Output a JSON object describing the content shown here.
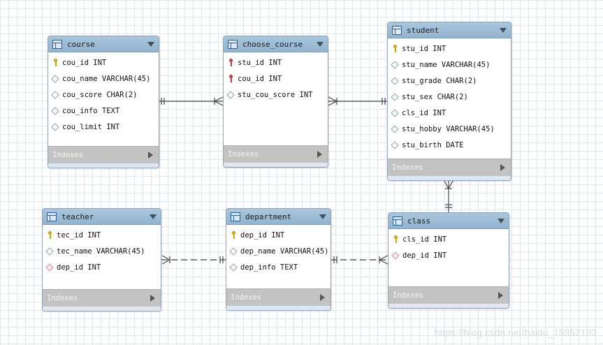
{
  "tables": [
    {
      "name": "course",
      "columns": [
        {
          "icon": "primary-key",
          "text": "cou_id INT"
        },
        {
          "icon": "column",
          "text": "cou_name VARCHAR(45)"
        },
        {
          "icon": "column",
          "text": "cou_score CHAR(2)"
        },
        {
          "icon": "column",
          "text": "cou_info TEXT"
        },
        {
          "icon": "column",
          "text": "cou_limit INT"
        }
      ],
      "footer": "Indexes"
    },
    {
      "name": "choose_course",
      "columns": [
        {
          "icon": "primary-foreign-key",
          "text": "stu_id INT"
        },
        {
          "icon": "primary-foreign-key",
          "text": "cou_id INT"
        },
        {
          "icon": "column",
          "text": "stu_cou_score INT"
        }
      ],
      "footer": "Indexes"
    },
    {
      "name": "student",
      "columns": [
        {
          "icon": "primary-key",
          "text": "stu_id INT"
        },
        {
          "icon": "column",
          "text": "stu_name VARCHAR(45)"
        },
        {
          "icon": "column",
          "text": "stu_grade CHAR(2)"
        },
        {
          "icon": "column",
          "text": "stu_sex CHAR(2)"
        },
        {
          "icon": "column",
          "text": "cls_id INT"
        },
        {
          "icon": "column",
          "text": "stu_hobby VARCHAR(45)"
        },
        {
          "icon": "column",
          "text": "stu_birth DATE"
        }
      ],
      "footer": "Indexes"
    },
    {
      "name": "teacher",
      "columns": [
        {
          "icon": "primary-key",
          "text": "tec_id INT"
        },
        {
          "icon": "column",
          "text": "tec_name VARCHAR(45)"
        },
        {
          "icon": "foreign-key",
          "text": "dep_id INT"
        }
      ],
      "footer": "Indexes"
    },
    {
      "name": "department",
      "columns": [
        {
          "icon": "primary-key",
          "text": "dep_id INT"
        },
        {
          "icon": "column",
          "text": "dep_name VARCHAR(45)"
        },
        {
          "icon": "column",
          "text": "dep_info TEXT"
        }
      ],
      "footer": "Indexes"
    },
    {
      "name": "class",
      "columns": [
        {
          "icon": "primary-key",
          "text": "cls_id INT"
        },
        {
          "icon": "foreign-key",
          "text": "dep_id INT"
        }
      ],
      "footer": "Indexes"
    }
  ],
  "relationships": [
    {
      "from": "course",
      "to": "choose_course",
      "identifying": true
    },
    {
      "from": "student",
      "to": "choose_course",
      "identifying": true
    },
    {
      "from": "class",
      "to": "student",
      "identifying": true
    },
    {
      "from": "department",
      "to": "teacher",
      "identifying": false
    },
    {
      "from": "department",
      "to": "class",
      "identifying": false
    }
  ],
  "watermark": "https://blog.csdn.net/baidu_15952103",
  "colors": {
    "header": "#9fbfd8",
    "footer": "#c3c3c3",
    "line": "#444444",
    "grid": "#e3e7ec"
  }
}
